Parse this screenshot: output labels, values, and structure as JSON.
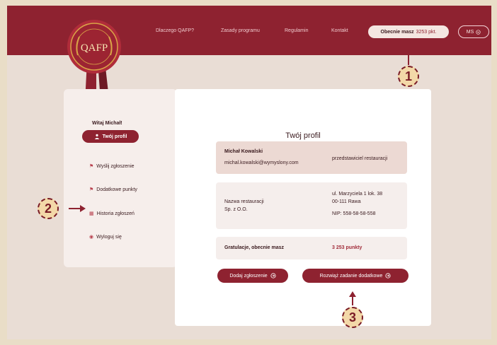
{
  "nav": {
    "links": [
      "Dlaczego QAFP?",
      "Zasady programu",
      "Regulamin",
      "Kontakt"
    ],
    "points_label": "Obecnie masz",
    "points_value": "3253 pkt.",
    "user_initials": "MS",
    "user_icon": "chevron-down-icon"
  },
  "logo": {
    "text": "QAFP"
  },
  "sidebar": {
    "greeting": "Witaj Michał!",
    "active_item": {
      "label": "Twój profil",
      "icon": "person-icon"
    },
    "items": [
      {
        "label": "Wyślij zgłoszenie",
        "icon": "flag-icon"
      },
      {
        "label": "Dodatkowe punkty",
        "icon": "flag-icon"
      },
      {
        "label": "Historia zgłoszeń",
        "icon": "calendar-icon"
      },
      {
        "label": "Wyloguj się",
        "icon": "logout-icon"
      }
    ]
  },
  "main": {
    "title": "Twój profil",
    "user": {
      "name": "Michał Kowalski",
      "email": "michal.kowalski@wymyslony.com",
      "role": "przedstawiciel restauracji"
    },
    "restaurant": {
      "name_line1": "Nazwa restauracji",
      "name_line2": "Sp. z O.O.",
      "address_line1": "ul. Marzyciela 1 lok. 38",
      "address_line2": "00-111 Rawa",
      "nip": "NIP: 558-58-58-558"
    },
    "points_text": "Gratulacje, obecnie masz",
    "points_value": "3 253 punkty",
    "buttons": {
      "add": "Dodaj zgłoszenie",
      "task": "Rozwiąż zadanie dodatkowe"
    }
  },
  "callouts": [
    "1",
    "2",
    "3"
  ],
  "colors": {
    "brand": "#8e2230",
    "background": "#e9ddd5",
    "callout_fill": "#f3d8a8"
  }
}
